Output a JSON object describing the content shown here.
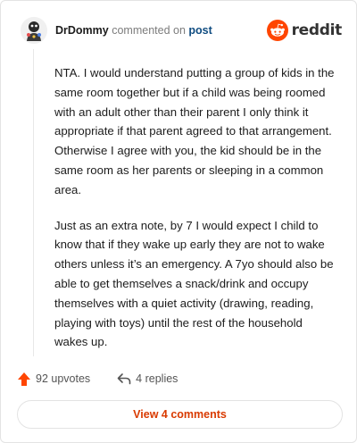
{
  "header": {
    "username": "DrDommy",
    "verb": "commented on",
    "post_link": "post",
    "brand_name": "reddit"
  },
  "comment": {
    "paragraphs": [
      "NTA. I would understand putting a group of kids in the same room together but if a child was being roomed with an adult other than their parent I only think it appropriate if that parent agreed to that arrangement. Otherwise I agree with you, the kid should be in the same room as her parents or sleeping in a common area.",
      "Just as an extra note, by 7 I would expect I child to know that if they wake up early they are not to wake others unless it’s an emergency. A 7yo should also be able to get themselves a snack/drink and occupy themselves with a quiet activity (drawing, reading, playing with toys) until the rest of the household wakes up."
    ]
  },
  "actions": {
    "upvotes": "92 upvotes",
    "replies": "4 replies"
  },
  "footer": {
    "view_comments": "View 4 comments"
  },
  "colors": {
    "brand": "#ff4500",
    "upvote": "#ff4500",
    "link": "#0f4c81",
    "button_text": "#d93a00"
  },
  "icons": {
    "avatar": "user-avatar",
    "brand": "reddit-snoo-icon",
    "upvote": "upvote-arrow-icon",
    "reply": "reply-arrow-icon"
  }
}
